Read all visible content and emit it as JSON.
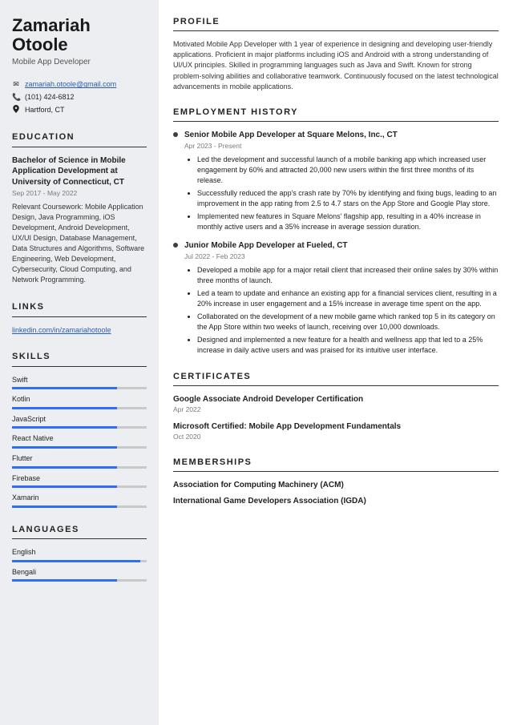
{
  "identity": {
    "name": "Zamariah Otoole",
    "title": "Mobile App Developer",
    "email": "zamariah.otoole@gmail.com",
    "phone": "(101) 424-6812",
    "location": "Hartford, CT"
  },
  "education": {
    "heading": "EDUCATION",
    "degree": "Bachelor of Science in Mobile Application Development at University of Connecticut, CT",
    "dates": "Sep 2017 - May 2022",
    "body": "Relevant Coursework: Mobile Application Design, Java Programming, iOS Development, Android Development, UX/UI Design, Database Management, Data Structures and Algorithms, Software Engineering, Web Development, Cybersecurity, Cloud Computing, and Network Programming."
  },
  "links": {
    "heading": "LINKS",
    "items": [
      {
        "text": "linkedin.com/in/zamariahotoole"
      }
    ]
  },
  "skills": {
    "heading": "SKILLS",
    "items": [
      {
        "name": "Swift",
        "level": 78
      },
      {
        "name": "Kotlin",
        "level": 78
      },
      {
        "name": "JavaScript",
        "level": 78
      },
      {
        "name": "React Native",
        "level": 78
      },
      {
        "name": "Flutter",
        "level": 78
      },
      {
        "name": "Firebase",
        "level": 78
      },
      {
        "name": "Xamarin",
        "level": 78
      }
    ]
  },
  "languages": {
    "heading": "LANGUAGES",
    "items": [
      {
        "name": "English",
        "level": 95
      },
      {
        "name": "Bengali",
        "level": 78
      }
    ]
  },
  "profile": {
    "heading": "PROFILE",
    "body": "Motivated Mobile App Developer with 1 year of experience in designing and developing user-friendly applications. Proficient in major platforms including iOS and Android with a strong understanding of UI/UX principles. Skilled in programming languages such as Java and Swift. Known for strong problem-solving abilities and collaborative teamwork. Continuously focused on the latest technological advancements in mobile applications."
  },
  "employment": {
    "heading": "EMPLOYMENT HISTORY",
    "jobs": [
      {
        "title": "Senior Mobile App Developer at Square Melons, Inc., CT",
        "dates": "Apr 2023 - Present",
        "bullets": [
          "Led the development and successful launch of a mobile banking app which increased user engagement by 60% and attracted 20,000 new users within the first three months of its release.",
          "Successfully reduced the app's crash rate by 70% by identifying and fixing bugs, leading to an improvement in the app rating from 2.5 to 4.7 stars on the App Store and Google Play store.",
          "Implemented new features in Square Melons' flagship app, resulting in a 40% increase in monthly active users and a 35% increase in average session duration."
        ]
      },
      {
        "title": "Junior Mobile App Developer at Fueled, CT",
        "dates": "Jul 2022 - Feb 2023",
        "bullets": [
          "Developed a mobile app for a major retail client that increased their online sales by 30% within three months of launch.",
          "Led a team to update and enhance an existing app for a financial services client, resulting in a 20% increase in user engagement and a 15% increase in average time spent on the app.",
          "Collaborated on the development of a new mobile game which ranked top 5 in its category on the App Store within two weeks of launch, receiving over 10,000 downloads.",
          "Designed and implemented a new feature for a health and wellness app that led to a 25% increase in daily active users and was praised for its intuitive user interface."
        ]
      }
    ]
  },
  "certificates": {
    "heading": "CERTIFICATES",
    "items": [
      {
        "title": "Google Associate Android Developer Certification",
        "date": "Apr 2022"
      },
      {
        "title": "Microsoft Certified: Mobile App Development Fundamentals",
        "date": "Oct 2020"
      }
    ]
  },
  "memberships": {
    "heading": "MEMBERSHIPS",
    "items": [
      "Association for Computing Machinery (ACM)",
      "International Game Developers Association (IGDA)"
    ]
  }
}
